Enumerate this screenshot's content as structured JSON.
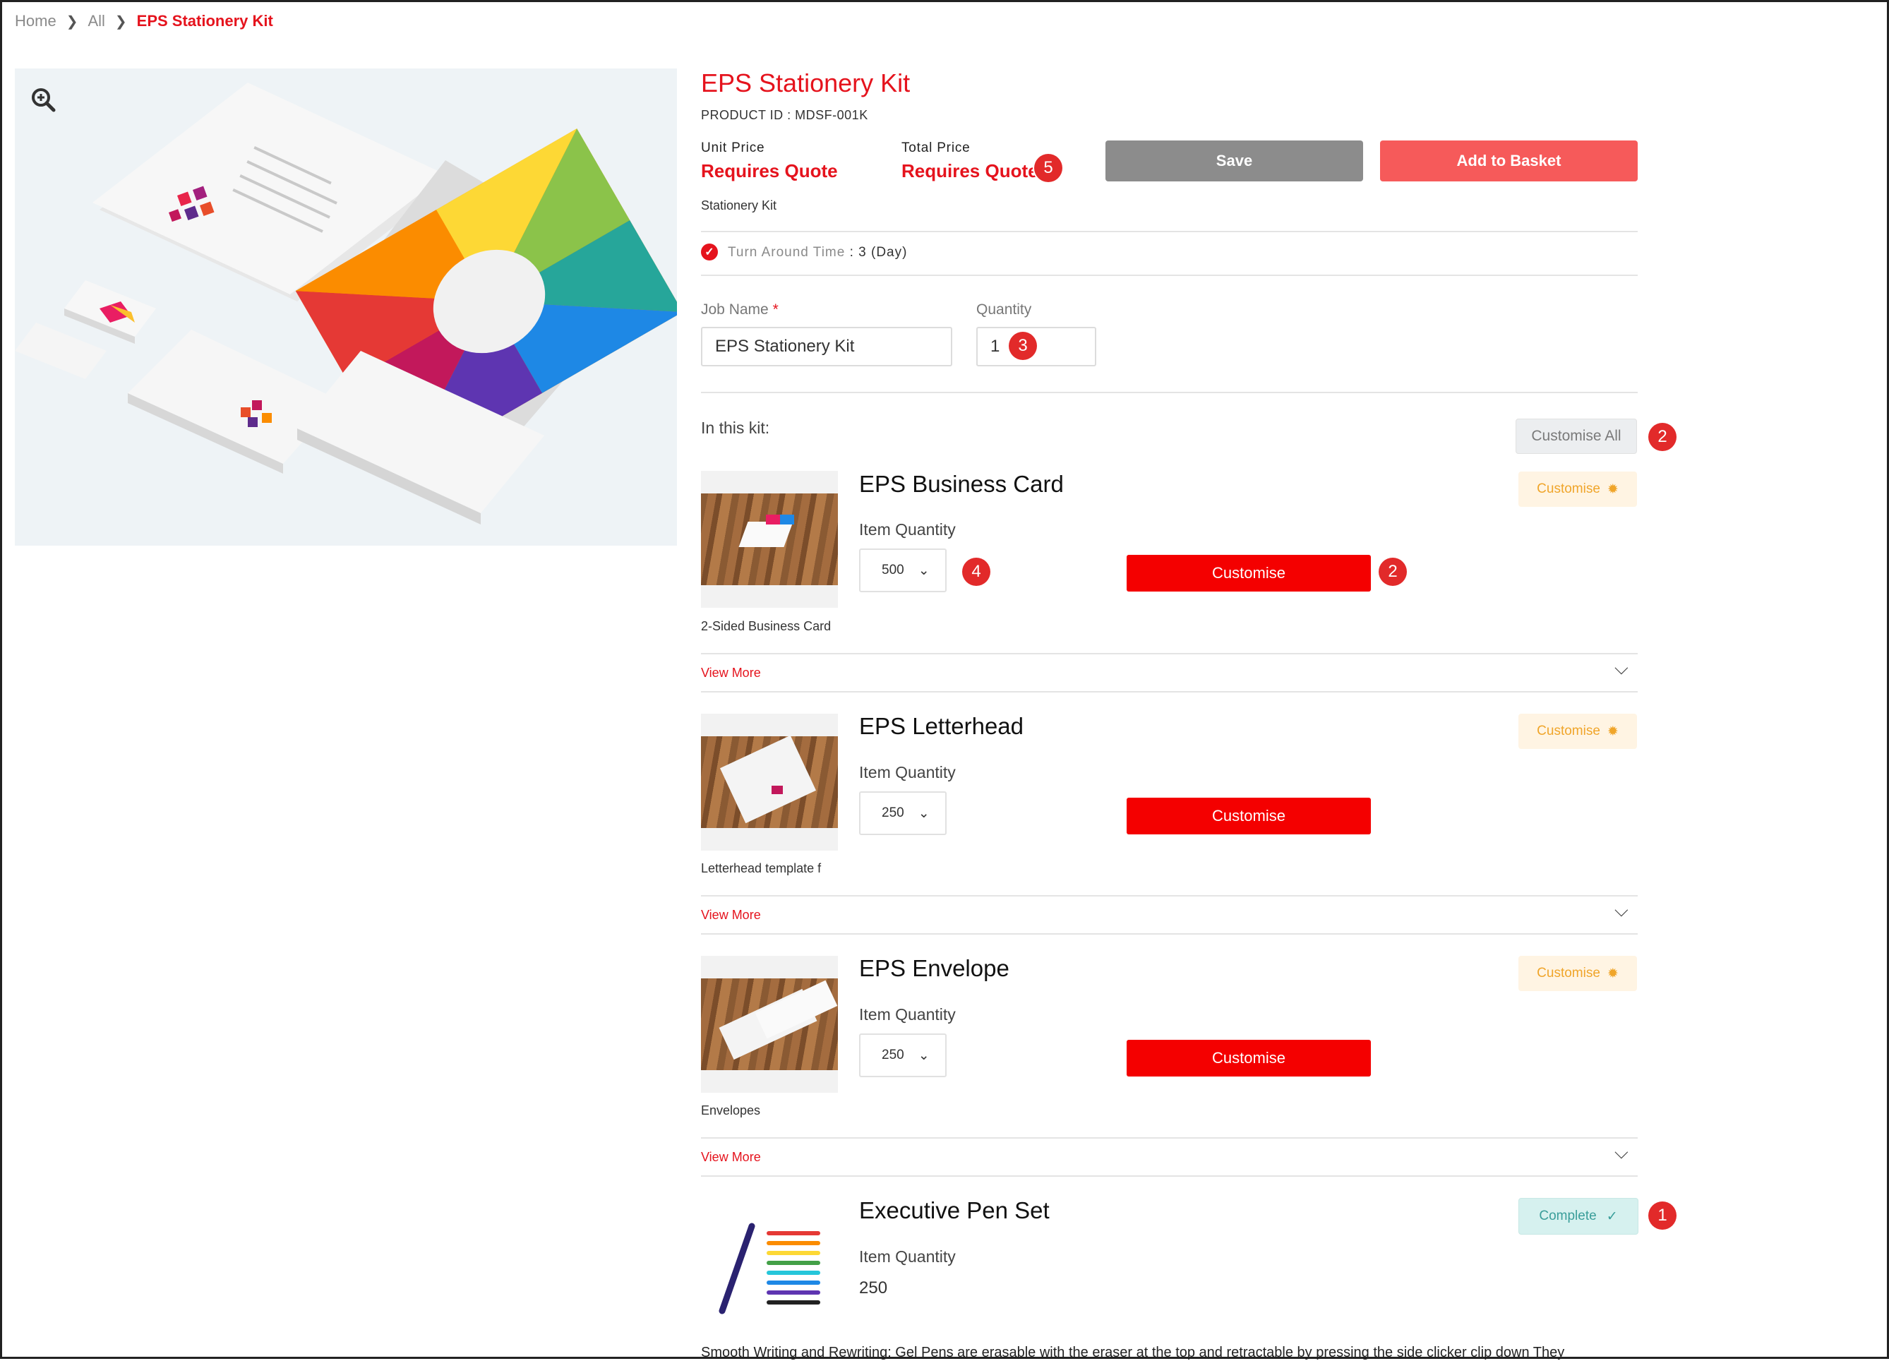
{
  "breadcrumb": {
    "home": "Home",
    "all": "All",
    "current": "EPS Stationery Kit"
  },
  "product": {
    "title": "EPS Stationery Kit",
    "product_id": "PRODUCT ID : MDSF-001K",
    "unit_price_label": "Unit Price",
    "unit_price": "Requires Quote",
    "total_price_label": "Total Price",
    "total_price": "Requires Quote",
    "subtitle": "Stationery Kit",
    "turnaround_label": "Turn Around Time",
    "turnaround_value": ": 3 (Day)",
    "save_label": "Save",
    "basket_label": "Add to Basket"
  },
  "form": {
    "job_name_label": "Job Name",
    "job_name_required": "*",
    "job_name_value": "EPS Stationery Kit",
    "quantity_label": "Quantity",
    "quantity_value": "1"
  },
  "kit": {
    "label": "In this kit:",
    "customise_all": "Customise All",
    "items": [
      {
        "name": "EPS Business Card",
        "qty_label": "Item Quantity",
        "qty": "500",
        "customise": "Customise",
        "customise_small": "Customise",
        "desc": "2-Sided Business Card",
        "view_more": "View More"
      },
      {
        "name": "EPS Letterhead",
        "qty_label": "Item Quantity",
        "qty": "250",
        "customise": "Customise",
        "customise_small": "Customise",
        "desc": "Letterhead template f",
        "view_more": "View More"
      },
      {
        "name": "EPS Envelope",
        "qty_label": "Item Quantity",
        "qty": "250",
        "customise": "Customise",
        "customise_small": "Customise",
        "desc": "Envelopes",
        "view_more": "View More"
      },
      {
        "name": "Executive Pen Set",
        "qty_label": "Item Quantity",
        "qty": "250",
        "status": "Complete",
        "desc": "Smooth Writing and Rewriting: Gel Pens are erasable with the eraser at the top and retractable by pressing the side clicker clip down They"
      }
    ]
  },
  "badges": {
    "b1": "1",
    "b2": "2",
    "b3": "3",
    "b4": "4",
    "b5": "5"
  },
  "colors": {
    "accent": "#e5131d",
    "button_red": "#f40000",
    "basket": "#f65a5a",
    "save": "#8c8c8c"
  }
}
